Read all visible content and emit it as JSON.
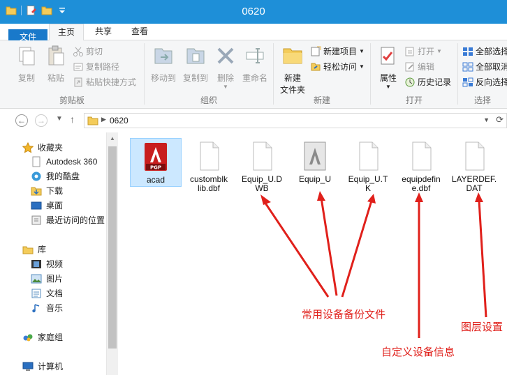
{
  "window": {
    "title": "0620"
  },
  "tabs": {
    "file": "文件",
    "home": "主页",
    "share": "共享",
    "view": "查看"
  },
  "ribbon": {
    "clipboard": {
      "label": "剪贴板",
      "copy": "复制",
      "paste": "粘贴",
      "cut": "剪切",
      "copy_path": "复制路径",
      "paste_shortcut": "粘贴快捷方式"
    },
    "organize": {
      "label": "组织",
      "move_to": "移动到",
      "copy_to": "复制到",
      "delete": "删除",
      "rename": "重命名"
    },
    "new": {
      "label": "新建",
      "new_folder_1": "新建",
      "new_folder_2": "文件夹",
      "new_item": "新建项目",
      "easy_access": "轻松访问"
    },
    "open": {
      "label": "打开",
      "properties": "属性",
      "open": "打开",
      "edit": "编辑",
      "history": "历史记录"
    },
    "select": {
      "label": "选择",
      "select_all": "全部选择",
      "select_none": "全部取消",
      "invert": "反向选择"
    }
  },
  "address": {
    "crumb": "0620"
  },
  "nav": {
    "favorites": "收藏夹",
    "autodesk": "Autodesk 360",
    "mydisk": "我的酷盘",
    "downloads": "下载",
    "desktop": "桌面",
    "recent": "最近访问的位置",
    "libraries": "库",
    "videos": "视频",
    "pictures": "图片",
    "documents": "文档",
    "music": "音乐",
    "homegroup": "家庭组",
    "computer": "计算机"
  },
  "files": [
    {
      "name": "acad",
      "icon": "pgp-icon"
    },
    {
      "name": "customblklib.dbf",
      "icon": "blank-file-icon"
    },
    {
      "name": "Equip_U.DWB",
      "icon": "blank-file-icon"
    },
    {
      "name": "Equip_U",
      "icon": "autocad-file-icon"
    },
    {
      "name": "Equip_U.TK",
      "icon": "blank-file-icon"
    },
    {
      "name": "equipdefine.dbf",
      "icon": "blank-file-icon"
    },
    {
      "name": "LAYERDEF.DAT",
      "icon": "blank-file-icon"
    }
  ],
  "file_labels": [
    "acad",
    "customblk\nlib.dbf",
    "Equip_U.D\nWB",
    "Equip_U",
    "Equip_U.T\nK",
    "equipdefin\ne.dbf",
    "LAYERDEF.\nDAT"
  ],
  "annotations": {
    "backup": "常用设备备份文件",
    "custom": "自定义设备信息",
    "layer": "图层设置"
  },
  "colors": {
    "titlebar": "#1e8fd8",
    "file_tab": "#1979ca",
    "annotation": "#e0201b",
    "selection": "#cce8ff"
  }
}
